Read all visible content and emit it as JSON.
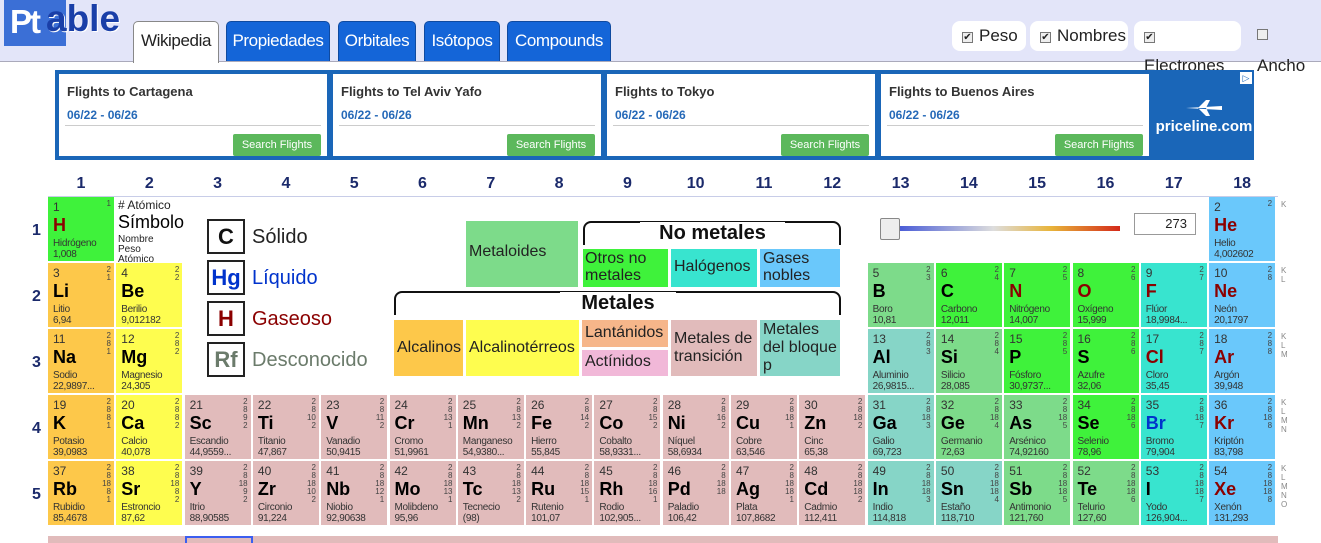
{
  "header": {
    "logo_pt": "Pt",
    "logo_rest": "able",
    "tabs": [
      "Wikipedia",
      "Propiedades",
      "Orbitales",
      "Isótopos",
      "Compounds"
    ],
    "checkboxes": [
      "Peso",
      "Nombres",
      "Electrones",
      "Ancho"
    ]
  },
  "ads": [
    {
      "title": "Flights to Cartagena",
      "dates": "06/22 - 06/26",
      "button": "Search Flights"
    },
    {
      "title": "Flights to Tel Aviv Yafo",
      "dates": "06/22 - 06/26",
      "button": "Search Flights"
    },
    {
      "title": "Flights to Tokyo",
      "dates": "06/22 - 06/26",
      "button": "Search Flights"
    },
    {
      "title": "Flights to Buenos Aires",
      "dates": "06/22 - 06/26",
      "button": "Search Flights"
    }
  ],
  "brand": "priceline.com",
  "groups": [
    "1",
    "2",
    "3",
    "4",
    "5",
    "6",
    "7",
    "8",
    "9",
    "10",
    "11",
    "12",
    "13",
    "14",
    "15",
    "16",
    "17",
    "18"
  ],
  "periods": [
    "1",
    "2",
    "3",
    "4",
    "5"
  ],
  "key": {
    "atomic": "# Atómico",
    "symbol": "Símbolo",
    "name": "Nombre",
    "weight": "Peso",
    "atomic2": "Atómico"
  },
  "states": [
    {
      "sym": "C",
      "label": "Sólido"
    },
    {
      "sym": "Hg",
      "label": "Líquido"
    },
    {
      "sym": "H",
      "label": "Gaseoso"
    },
    {
      "sym": "Rf",
      "label": "Desconocido"
    }
  ],
  "categories": {
    "metalloids": "Metaloides",
    "nonmetals_title": "No metales",
    "other_nonmetals": "Otros no metales",
    "halogens": "Halógenos",
    "noble_gases": "Gases nobles",
    "metals_title": "Metales",
    "alkali": "Alcalinos",
    "alkaline_earth": "Alcalinotérreos",
    "lanthanides": "Lantánidos",
    "actinides": "Actínidos",
    "transition": "Metales de transición",
    "post_transition": "Metales del bloque p"
  },
  "temperature": "273",
  "elements": [
    {
      "n": "1",
      "s": "H",
      "name": "Hidrógeno",
      "w": "1,008",
      "sh": "1",
      "c": "c-on",
      "st": "gas"
    },
    {
      "n": "2",
      "s": "He",
      "name": "Helio",
      "w": "4,002602",
      "sh": "2",
      "c": "c-ng",
      "st": "gas"
    },
    {
      "n": "3",
      "s": "Li",
      "name": "Litio",
      "w": "6,94",
      "sh": "2\n1",
      "c": "c-alk",
      "st": ""
    },
    {
      "n": "4",
      "s": "Be",
      "name": "Berilio",
      "w": "9,012182",
      "sh": "2\n2",
      "c": "c-ae",
      "st": ""
    },
    {
      "n": "5",
      "s": "B",
      "name": "Boro",
      "w": "10,81",
      "sh": "2\n3",
      "c": "c-md",
      "st": ""
    },
    {
      "n": "6",
      "s": "C",
      "name": "Carbono",
      "w": "12,011",
      "sh": "2\n4",
      "c": "c-on",
      "st": ""
    },
    {
      "n": "7",
      "s": "N",
      "name": "Nitrógeno",
      "w": "14,007",
      "sh": "2\n5",
      "c": "c-on",
      "st": "gas"
    },
    {
      "n": "8",
      "s": "O",
      "name": "Oxígeno",
      "w": "15,999",
      "sh": "2\n6",
      "c": "c-on",
      "st": "gas"
    },
    {
      "n": "9",
      "s": "F",
      "name": "Flúor",
      "w": "18,9984...",
      "sh": "2\n7",
      "c": "c-hal",
      "st": "gas"
    },
    {
      "n": "10",
      "s": "Ne",
      "name": "Neón",
      "w": "20,1797",
      "sh": "2\n8",
      "c": "c-ng",
      "st": "gas"
    },
    {
      "n": "11",
      "s": "Na",
      "name": "Sodio",
      "w": "22,9897...",
      "sh": "2\n8\n1",
      "c": "c-alk",
      "st": ""
    },
    {
      "n": "12",
      "s": "Mg",
      "name": "Magnesio",
      "w": "24,305",
      "sh": "2\n8\n2",
      "c": "c-ae",
      "st": ""
    },
    {
      "n": "13",
      "s": "Al",
      "name": "Aluminio",
      "w": "26,9815...",
      "sh": "2\n8\n3",
      "c": "c-pt",
      "st": ""
    },
    {
      "n": "14",
      "s": "Si",
      "name": "Silicio",
      "w": "28,085",
      "sh": "2\n8\n4",
      "c": "c-md",
      "st": ""
    },
    {
      "n": "15",
      "s": "P",
      "name": "Fósforo",
      "w": "30,9737...",
      "sh": "2\n8\n5",
      "c": "c-on",
      "st": ""
    },
    {
      "n": "16",
      "s": "S",
      "name": "Azufre",
      "w": "32,06",
      "sh": "2\n8\n6",
      "c": "c-on",
      "st": ""
    },
    {
      "n": "17",
      "s": "Cl",
      "name": "Cloro",
      "w": "35,45",
      "sh": "2\n8\n7",
      "c": "c-hal",
      "st": "gas"
    },
    {
      "n": "18",
      "s": "Ar",
      "name": "Argón",
      "w": "39,948",
      "sh": "2\n8\n8",
      "c": "c-ng",
      "st": "gas"
    },
    {
      "n": "19",
      "s": "K",
      "name": "Potasio",
      "w": "39,0983",
      "sh": "2\n8\n8\n1",
      "c": "c-alk",
      "st": ""
    },
    {
      "n": "20",
      "s": "Ca",
      "name": "Calcio",
      "w": "40,078",
      "sh": "2\n8\n8\n2",
      "c": "c-ae",
      "st": ""
    },
    {
      "n": "21",
      "s": "Sc",
      "name": "Escandio",
      "w": "44,9559...",
      "sh": "2\n8\n9\n2",
      "c": "c-tm",
      "st": ""
    },
    {
      "n": "22",
      "s": "Ti",
      "name": "Titanio",
      "w": "47,867",
      "sh": "2\n8\n10\n2",
      "c": "c-tm",
      "st": ""
    },
    {
      "n": "23",
      "s": "V",
      "name": "Vanadio",
      "w": "50,9415",
      "sh": "2\n8\n11\n2",
      "c": "c-tm",
      "st": ""
    },
    {
      "n": "24",
      "s": "Cr",
      "name": "Cromo",
      "w": "51,9961",
      "sh": "2\n8\n13\n1",
      "c": "c-tm",
      "st": ""
    },
    {
      "n": "25",
      "s": "Mn",
      "name": "Manganeso",
      "w": "54,9380...",
      "sh": "2\n8\n13\n2",
      "c": "c-tm",
      "st": ""
    },
    {
      "n": "26",
      "s": "Fe",
      "name": "Hierro",
      "w": "55,845",
      "sh": "2\n8\n14\n2",
      "c": "c-tm",
      "st": ""
    },
    {
      "n": "27",
      "s": "Co",
      "name": "Cobalto",
      "w": "58,9331...",
      "sh": "2\n8\n15\n2",
      "c": "c-tm",
      "st": ""
    },
    {
      "n": "28",
      "s": "Ni",
      "name": "Níquel",
      "w": "58,6934",
      "sh": "2\n8\n16\n2",
      "c": "c-tm",
      "st": ""
    },
    {
      "n": "29",
      "s": "Cu",
      "name": "Cobre",
      "w": "63,546",
      "sh": "2\n8\n18\n1",
      "c": "c-tm",
      "st": ""
    },
    {
      "n": "30",
      "s": "Zn",
      "name": "Cinc",
      "w": "65,38",
      "sh": "2\n8\n18\n2",
      "c": "c-tm",
      "st": ""
    },
    {
      "n": "31",
      "s": "Ga",
      "name": "Galio",
      "w": "69,723",
      "sh": "2\n8\n18\n3",
      "c": "c-pt",
      "st": ""
    },
    {
      "n": "32",
      "s": "Ge",
      "name": "Germanio",
      "w": "72,63",
      "sh": "2\n8\n18\n4",
      "c": "c-md",
      "st": ""
    },
    {
      "n": "33",
      "s": "As",
      "name": "Arsénico",
      "w": "74,92160",
      "sh": "2\n8\n18\n5",
      "c": "c-md",
      "st": ""
    },
    {
      "n": "34",
      "s": "Se",
      "name": "Selenio",
      "w": "78,96",
      "sh": "2\n8\n18\n6",
      "c": "c-on",
      "st": ""
    },
    {
      "n": "35",
      "s": "Br",
      "name": "Bromo",
      "w": "79,904",
      "sh": "2\n8\n18\n7",
      "c": "c-hal",
      "st": "liq"
    },
    {
      "n": "36",
      "s": "Kr",
      "name": "Kriptón",
      "w": "83,798",
      "sh": "2\n8\n18\n8",
      "c": "c-ng",
      "st": "gas"
    },
    {
      "n": "37",
      "s": "Rb",
      "name": "Rubidio",
      "w": "85,4678",
      "sh": "2\n8\n18\n8\n1",
      "c": "c-alk",
      "st": ""
    },
    {
      "n": "38",
      "s": "Sr",
      "name": "Estroncio",
      "w": "87,62",
      "sh": "2\n8\n18\n8\n2",
      "c": "c-ae",
      "st": ""
    },
    {
      "n": "39",
      "s": "Y",
      "name": "Itrio",
      "w": "88,90585",
      "sh": "2\n8\n18\n9\n2",
      "c": "c-tm",
      "st": ""
    },
    {
      "n": "40",
      "s": "Zr",
      "name": "Circonio",
      "w": "91,224",
      "sh": "2\n8\n18\n10\n2",
      "c": "c-tm",
      "st": ""
    },
    {
      "n": "41",
      "s": "Nb",
      "name": "Niobio",
      "w": "92,90638",
      "sh": "2\n8\n18\n12\n1",
      "c": "c-tm",
      "st": ""
    },
    {
      "n": "42",
      "s": "Mo",
      "name": "Molibdeno",
      "w": "95,96",
      "sh": "2\n8\n18\n13\n1",
      "c": "c-tm",
      "st": ""
    },
    {
      "n": "43",
      "s": "Tc",
      "name": "Tecnecio",
      "w": "(98)",
      "sh": "2\n8\n18\n13\n2",
      "c": "c-tm",
      "st": ""
    },
    {
      "n": "44",
      "s": "Ru",
      "name": "Rutenio",
      "w": "101,07",
      "sh": "2\n8\n18\n15\n1",
      "c": "c-tm",
      "st": ""
    },
    {
      "n": "45",
      "s": "Rh",
      "name": "Rodio",
      "w": "102,905...",
      "sh": "2\n8\n18\n16\n1",
      "c": "c-tm",
      "st": ""
    },
    {
      "n": "46",
      "s": "Pd",
      "name": "Paladio",
      "w": "106,42",
      "sh": "2\n8\n18\n18",
      "c": "c-tm",
      "st": ""
    },
    {
      "n": "47",
      "s": "Ag",
      "name": "Plata",
      "w": "107,8682",
      "sh": "2\n8\n18\n18\n1",
      "c": "c-tm",
      "st": ""
    },
    {
      "n": "48",
      "s": "Cd",
      "name": "Cadmio",
      "w": "112,411",
      "sh": "2\n8\n18\n18\n2",
      "c": "c-tm",
      "st": ""
    },
    {
      "n": "49",
      "s": "In",
      "name": "Indio",
      "w": "114,818",
      "sh": "2\n8\n18\n18\n3",
      "c": "c-pt",
      "st": ""
    },
    {
      "n": "50",
      "s": "Sn",
      "name": "Estaño",
      "w": "118,710",
      "sh": "2\n8\n18\n18\n4",
      "c": "c-pt",
      "st": ""
    },
    {
      "n": "51",
      "s": "Sb",
      "name": "Antimonio",
      "w": "121,760",
      "sh": "2\n8\n18\n18\n5",
      "c": "c-md",
      "st": ""
    },
    {
      "n": "52",
      "s": "Te",
      "name": "Telurio",
      "w": "127,60",
      "sh": "2\n8\n18\n18\n6",
      "c": "c-md",
      "st": ""
    },
    {
      "n": "53",
      "s": "I",
      "name": "Yodo",
      "w": "126,904...",
      "sh": "2\n8\n18\n18\n7",
      "c": "c-hal",
      "st": ""
    },
    {
      "n": "54",
      "s": "Xe",
      "name": "Xenón",
      "w": "131,293",
      "sh": "2\n8\n18\n18\n8",
      "c": "c-ng",
      "st": "gas"
    }
  ],
  "shell_letters": [
    "K",
    "K\nL",
    "K\nL\nM",
    "K\nL\nM\nN",
    "K\nL\nM\nN\nO"
  ]
}
